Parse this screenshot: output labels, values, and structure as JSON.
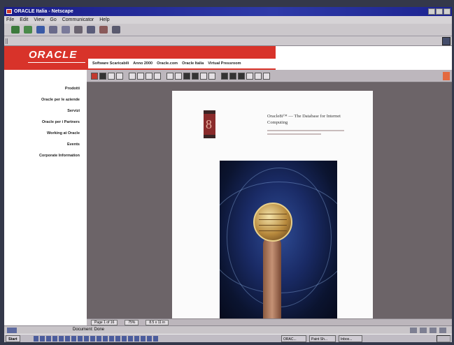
{
  "window": {
    "title": "ORACLE Italia - Netscape",
    "menu": [
      "File",
      "Edit",
      "View",
      "Go",
      "Communicator",
      "Help"
    ]
  },
  "oracle": {
    "logo_text": "ORACLE",
    "top_nav": [
      "Software Scaricabili",
      "Anno 2000",
      "Oracle.com",
      "Oracle Italia",
      "Virtual Pressroom"
    ],
    "sidebar": [
      "Prodotti",
      "Oracle per le aziende",
      "Servizi",
      "Oracle per i Partners",
      "Working at Oracle",
      "Events",
      "Corporate Information"
    ]
  },
  "document": {
    "title": "Oracle8i™ — The Database for Internet Computing",
    "logo_glyph": "8"
  },
  "viewer_status": {
    "page": "Page 1 of 16",
    "zoom": "75%",
    "size": "8.5 x 11 in"
  },
  "browser_status": {
    "text": "Document: Done"
  },
  "taskbar": {
    "start_label": "Start",
    "tasks": [
      "ORAC...",
      "Paint Sh...",
      "Inbox..."
    ]
  },
  "colors": {
    "oracle_red": "#d8332a",
    "title_blue": "#1a1d8a"
  }
}
